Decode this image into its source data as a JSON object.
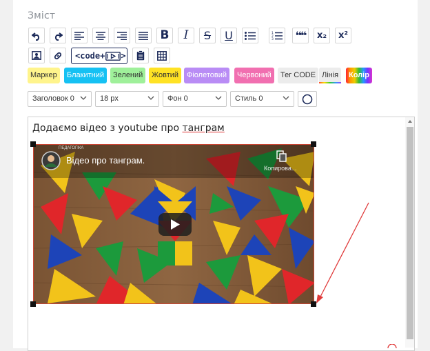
{
  "section": {
    "title": "Зміст"
  },
  "toolbar": {
    "row1": [
      {
        "name": "undo-icon"
      },
      {
        "name": "redo-icon"
      },
      {
        "name": "align-left-icon"
      },
      {
        "name": "align-center-icon"
      },
      {
        "name": "align-right-icon"
      },
      {
        "name": "align-justify-icon"
      },
      {
        "name": "bold-icon",
        "glyph": "B"
      },
      {
        "name": "italic-icon",
        "glyph": "I"
      },
      {
        "name": "strikethrough-icon",
        "glyph": "S"
      },
      {
        "name": "underline-icon",
        "glyph": "U"
      },
      {
        "name": "bullet-list-icon"
      },
      {
        "name": "numbered-list-icon"
      },
      {
        "name": "quote-icon",
        "glyph": "❝❝"
      },
      {
        "name": "subscript-icon",
        "glyph": "x₂"
      },
      {
        "name": "superscript-icon",
        "glyph": "x²"
      }
    ],
    "code_label": "<code+",
    "row2": [
      "image-icon",
      "link-icon",
      "code-embed-icon",
      "clipboard-list-icon",
      "table-icon"
    ]
  },
  "chips": [
    {
      "label": "Маркер",
      "bg": "#fff48c",
      "color": "#333333"
    },
    {
      "label": "Блакитний",
      "bg": "#16c1f3",
      "color": "#ffffff"
    },
    {
      "label": "Зелений",
      "bg": "#9ff09a",
      "color": "#333333"
    },
    {
      "label": "Жовтий",
      "bg": "#ffe224",
      "color": "#333333"
    },
    {
      "label": "Фіолетовий",
      "bg": "#b98cf5",
      "color": "#ffffff"
    },
    {
      "label": "Червоний",
      "bg": "#f16fb0",
      "color": "#ffffff"
    },
    {
      "label": "Тег CODE",
      "bg": "#ececec",
      "color": "#333333"
    },
    {
      "label": "Лінія",
      "bg": "#ececec",
      "color": "#333333"
    },
    {
      "label": "Колір",
      "bg": "#7a3cf0",
      "color": "#ffffff"
    }
  ],
  "selects": {
    "heading": "Заголовок 0",
    "size": "18 px",
    "background": "Фон 0",
    "style": "Стиль 0"
  },
  "editor": {
    "text_before": "Додаємо відео з youtube про ",
    "text_misspelled": "танграм"
  },
  "video": {
    "title": "Відео про танграм.",
    "copy_label": "Копирова...",
    "channel_badge": "ПЕДАГОГІКА"
  },
  "colors": {
    "accent": "#1d2b5a",
    "annotation_arrow": "#e03a3a"
  }
}
